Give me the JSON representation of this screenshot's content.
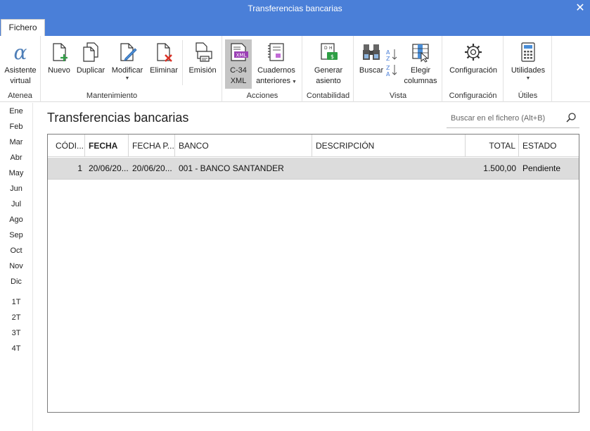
{
  "window": {
    "title": "Transferencias bancarias",
    "close_glyph": "✕"
  },
  "tabs": [
    {
      "label": "Fichero",
      "active": true
    }
  ],
  "ribbon": {
    "groups": [
      {
        "label": "Atenea",
        "buttons": [
          {
            "label": "Asistente\nvirtual",
            "icon": "alpha-icon"
          }
        ]
      },
      {
        "label": "Mantenimiento",
        "buttons": [
          {
            "label": "Nuevo",
            "icon": "new-document-icon"
          },
          {
            "label": "Duplicar",
            "icon": "duplicate-icon"
          },
          {
            "label": "Modificar",
            "icon": "edit-document-icon",
            "dropdown": true
          },
          {
            "label": "Eliminar",
            "icon": "delete-document-icon"
          },
          {
            "label": "Emisión",
            "icon": "print-icon"
          }
        ]
      },
      {
        "label": "Acciones",
        "buttons": [
          {
            "label": "C-34\nXML",
            "icon": "xml-file-icon",
            "selected": true
          },
          {
            "label": "Cuadernos\nanteriores",
            "icon": "notebooks-icon",
            "dropdown": true
          }
        ]
      },
      {
        "label": "Contabilidad",
        "buttons": [
          {
            "label": "Generar\nasiento",
            "icon": "journal-entry-icon"
          }
        ]
      },
      {
        "label": "Vista",
        "buttons": [
          {
            "label": "Buscar",
            "icon": "binoculars-icon"
          },
          {
            "label": "",
            "icon": "sort-az-icon"
          },
          {
            "label": "Elegir\ncolumnas",
            "icon": "choose-columns-icon"
          }
        ]
      },
      {
        "label": "Configuración",
        "buttons": [
          {
            "label": "Configuración",
            "icon": "gear-icon"
          }
        ]
      },
      {
        "label": "Útiles",
        "buttons": [
          {
            "label": "Utilidades",
            "icon": "calculator-icon",
            "dropdown": true
          }
        ]
      }
    ]
  },
  "months": [
    "Ene",
    "Feb",
    "Mar",
    "Abr",
    "May",
    "Jun",
    "Jul",
    "Ago",
    "Sep",
    "Oct",
    "Nov",
    "Dic"
  ],
  "quarters": [
    "1T",
    "2T",
    "3T",
    "4T"
  ],
  "page": {
    "title": "Transferencias bancarias"
  },
  "search": {
    "placeholder": "Buscar en el fichero (Alt+B)"
  },
  "table": {
    "columns": [
      "CÓDI...",
      "FECHA",
      "FECHA P...",
      "BANCO",
      "DESCRIPCIÓN",
      "TOTAL",
      "ESTADO"
    ],
    "rows": [
      {
        "codigo": "1",
        "fecha": "20/06/20...",
        "fecha_p": "20/06/20...",
        "banco": "001 - BANCO SANTANDER",
        "descripcion": "",
        "total": "1.500,00",
        "estado": "Pendiente"
      }
    ]
  },
  "colors": {
    "titlebar": "#4a7fd8",
    "selected_row": "#dcdcdc",
    "accent_green": "#2e9e44",
    "accent_red": "#d93025",
    "accent_purple": "#9b3fb5"
  }
}
